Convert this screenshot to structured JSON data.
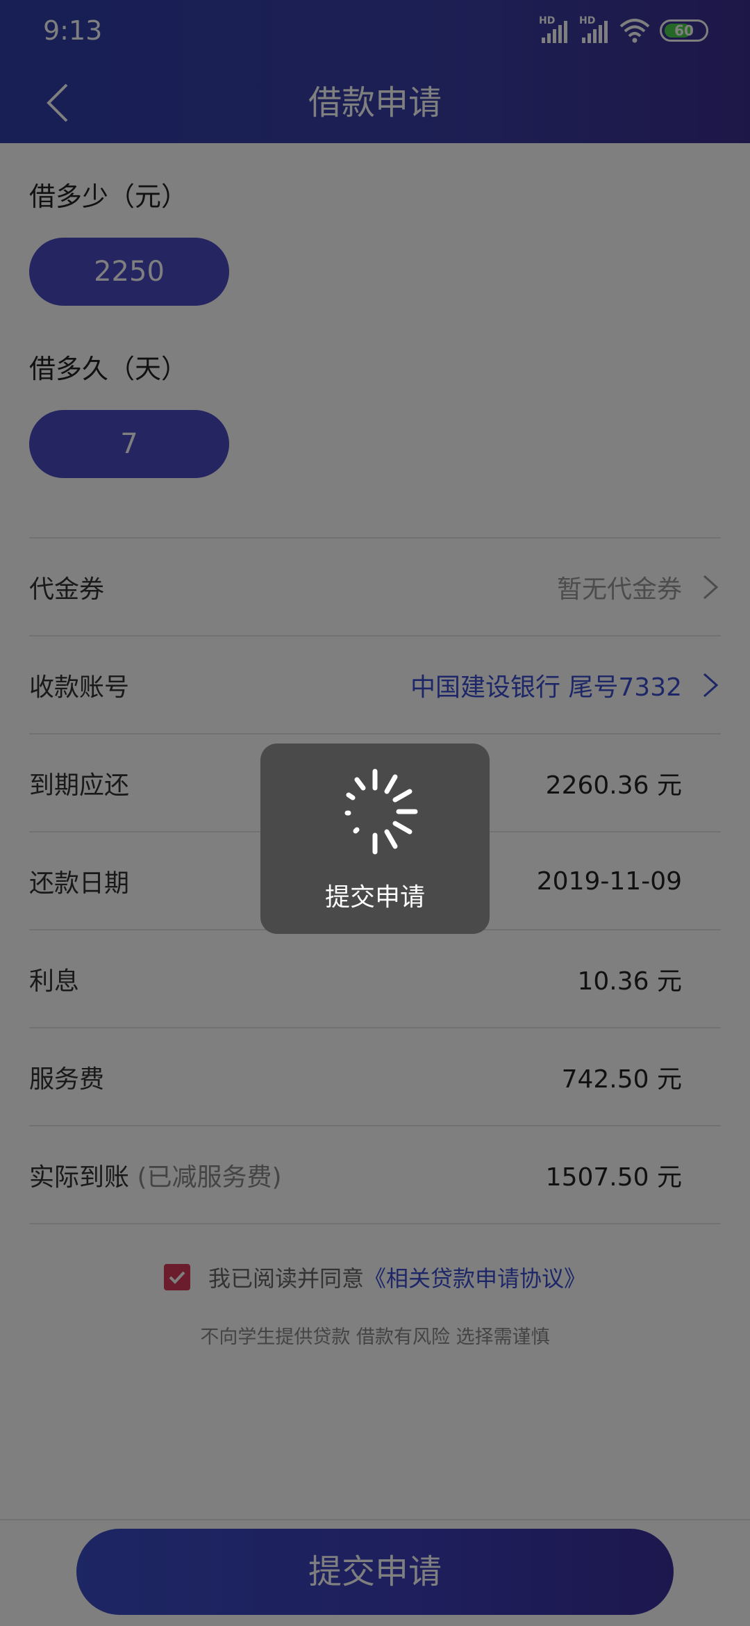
{
  "status_bar": {
    "time": "9:13",
    "battery": "60",
    "signal_label": "HD"
  },
  "header": {
    "title": "借款申请"
  },
  "amount": {
    "label": "借多少（元）",
    "value": "2250"
  },
  "duration": {
    "label": "借多久（天）",
    "value": "7"
  },
  "rows": {
    "coupon": {
      "label": "代金券",
      "value": "暂无代金券"
    },
    "account": {
      "label": "收款账号",
      "value": "中国建设银行  尾号7332"
    },
    "due": {
      "label": "到期应还",
      "value": "2260.36 元"
    },
    "repay_date": {
      "label": "还款日期",
      "value": "2019-11-09"
    },
    "interest": {
      "label": "利息",
      "value": "10.36 元"
    },
    "service_fee": {
      "label": "服务费",
      "value": "742.50 元"
    },
    "actual": {
      "label": "实际到账",
      "sub": " (已减服务费)",
      "value": "1507.50 元"
    }
  },
  "agreement": {
    "text": "我已阅读并同意",
    "link": "《相关贷款申请协议》",
    "checked": true
  },
  "notice": "不向学生提供贷款 借款有风险 选择需谨慎",
  "submit_label": "提交申请",
  "toast": {
    "text": "提交申请"
  },
  "colors": {
    "primary": "#4a4bc4",
    "link": "#3a4fd0",
    "checkbox": "#d83a5a"
  }
}
